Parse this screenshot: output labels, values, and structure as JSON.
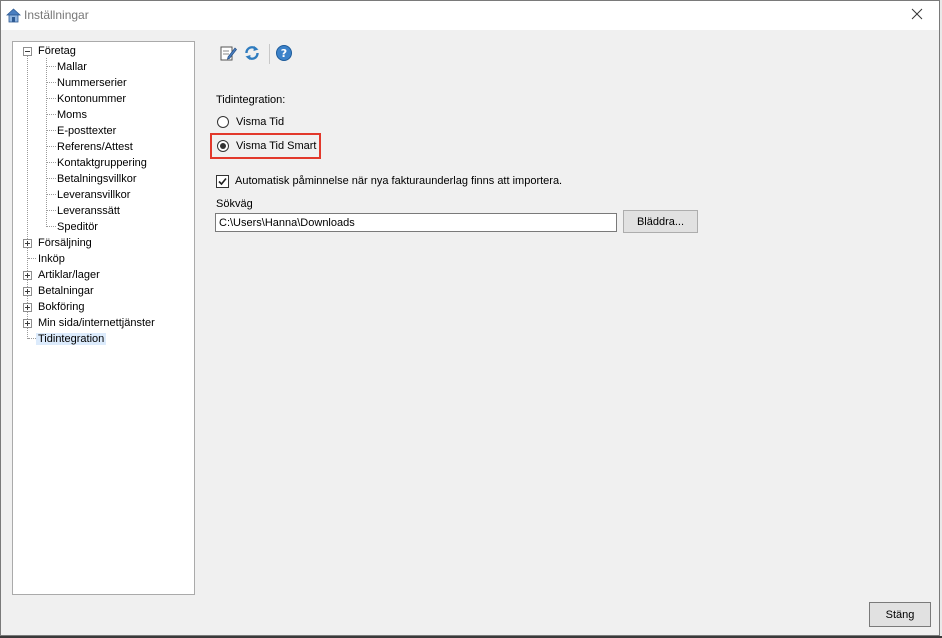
{
  "window": {
    "title": "Inställningar",
    "close_symbol": "×"
  },
  "toolbar": {
    "icons": [
      "edit-icon",
      "refresh-icon",
      "help-icon"
    ]
  },
  "tree": {
    "foretag": {
      "label": "Företag",
      "children": [
        "Mallar",
        "Nummerserier",
        "Kontonummer",
        "Moms",
        "E-posttexter",
        "Referens/Attest",
        "Kontaktgruppering",
        "Betalningsvillkor",
        "Leveransvillkor",
        "Leveranssätt",
        "Speditör"
      ]
    },
    "forsaljning": "Försäljning",
    "inkop": "Inköp",
    "artiklar": "Artiklar/lager",
    "betalningar": "Betalningar",
    "bokforing": "Bokföring",
    "minsida": "Min sida/internettjänster",
    "tidintegration": "Tidintegration",
    "selected": "Tidintegration"
  },
  "panel": {
    "section_label": "Tidintegration:",
    "options": [
      "Visma Tid",
      "Visma Tid Smart"
    ],
    "selected_option": "Visma Tid Smart",
    "reminder_label": "Automatisk påminnelse när nya fakturaunderlag finns att importera.",
    "reminder_checked": true,
    "path_label": "Sökväg",
    "path_value": "C:\\Users\\Hanna\\Downloads",
    "browse_button": "Bläddra..."
  },
  "footer": {
    "close_button": "Stäng"
  },
  "colors": {
    "highlight": "#e2382b",
    "selection": "#dcebfc"
  }
}
